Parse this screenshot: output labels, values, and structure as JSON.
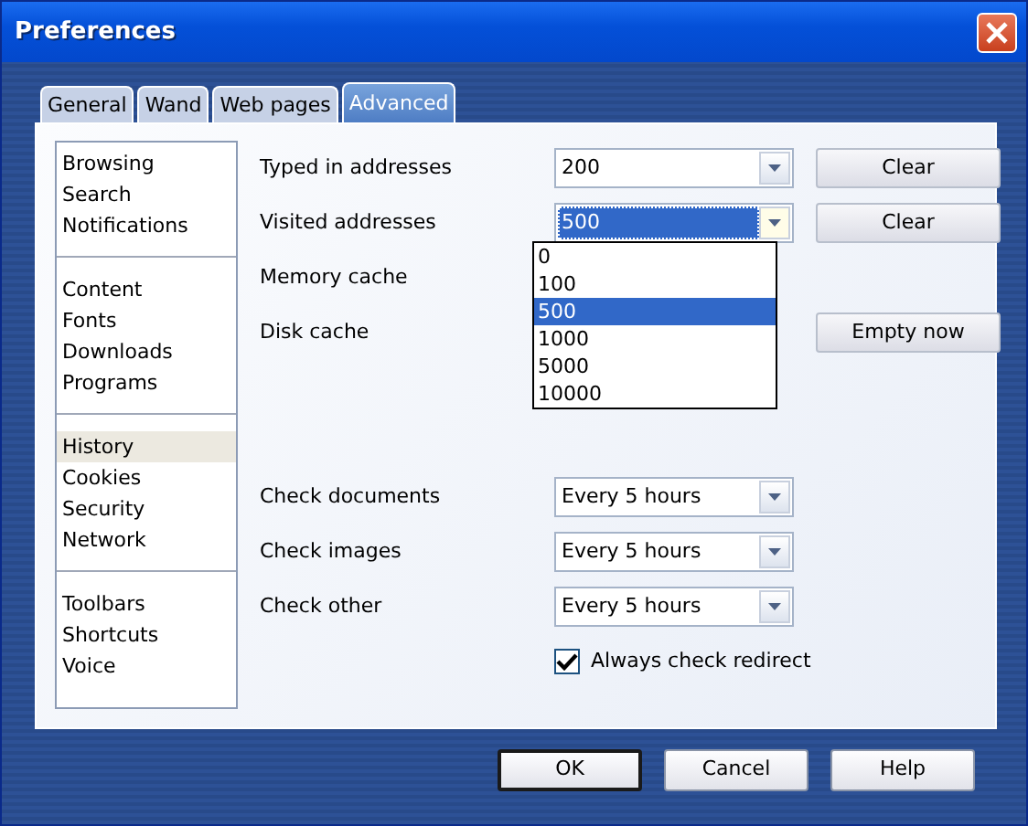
{
  "window": {
    "title": "Preferences"
  },
  "tabs": [
    {
      "label": "General",
      "selected": false
    },
    {
      "label": "Wand",
      "selected": false
    },
    {
      "label": "Web pages",
      "selected": false
    },
    {
      "label": "Advanced",
      "selected": true
    }
  ],
  "sidebar": {
    "groups": [
      [
        {
          "label": "Browsing",
          "selected": false
        },
        {
          "label": "Search",
          "selected": false
        },
        {
          "label": "Notifications",
          "selected": false
        }
      ],
      [
        {
          "label": "Content",
          "selected": false
        },
        {
          "label": "Fonts",
          "selected": false
        },
        {
          "label": "Downloads",
          "selected": false
        },
        {
          "label": "Programs",
          "selected": false
        }
      ],
      [
        {
          "label": "History",
          "selected": true
        },
        {
          "label": "Cookies",
          "selected": false
        },
        {
          "label": "Security",
          "selected": false
        },
        {
          "label": "Network",
          "selected": false
        }
      ],
      [
        {
          "label": "Toolbars",
          "selected": false
        },
        {
          "label": "Shortcuts",
          "selected": false
        },
        {
          "label": "Voice",
          "selected": false
        }
      ]
    ]
  },
  "sections": [
    [
      {
        "kind": "combo",
        "label": "Typed in addresses",
        "value": "200",
        "focused": false,
        "button": "Clear"
      },
      {
        "kind": "combo",
        "label": "Visited addresses",
        "value": "500",
        "focused": true,
        "button": "Clear",
        "options": [
          {
            "label": "0",
            "selected": false
          },
          {
            "label": "100",
            "selected": false
          },
          {
            "label": "500",
            "selected": true
          },
          {
            "label": "1000",
            "selected": false
          },
          {
            "label": "5000",
            "selected": false
          },
          {
            "label": "10000",
            "selected": false
          }
        ]
      },
      {
        "kind": "label",
        "label": "Memory cache"
      },
      {
        "kind": "label",
        "label": "Disk cache",
        "button": "Empty now"
      }
    ],
    [
      {
        "kind": "combo",
        "label": "Check documents",
        "value": "Every 5 hours",
        "focused": false
      },
      {
        "kind": "combo",
        "label": "Check images",
        "value": "Every 5 hours",
        "focused": false
      },
      {
        "kind": "combo",
        "label": "Check other",
        "value": "Every 5 hours",
        "focused": false
      },
      {
        "kind": "checkbox",
        "label": "Always check redirect",
        "checked": true
      }
    ]
  ],
  "buttons": [
    {
      "label": "OK",
      "default": true
    },
    {
      "label": "Cancel",
      "default": false
    },
    {
      "label": "Help",
      "default": false
    }
  ]
}
